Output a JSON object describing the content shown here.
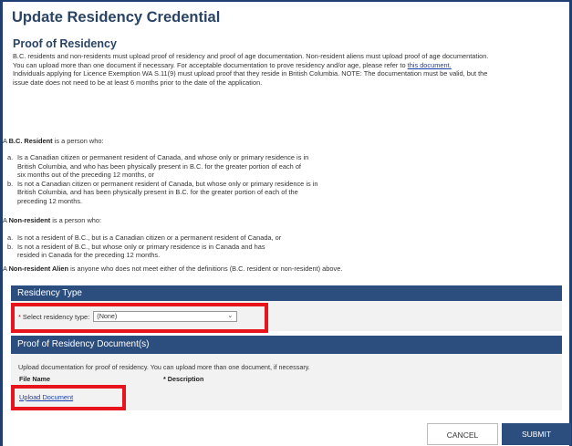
{
  "page": {
    "title": "Update Residency Credential"
  },
  "proof": {
    "heading": "Proof of Residency",
    "intro_line1": "B.C. residents and non-residents must upload proof of residency and proof of age documentation. Non-resident aliens must upload proof of age documentation.",
    "intro_line2": "You can upload more than one document if necessary. For acceptable documentation to prove residency and/or age, please refer to",
    "intro_link": "this document.",
    "intro_line3": "Individuals applying for Licence Exemption WA S.11(9) must upload proof that they reside in British Columbia. NOTE: The documentation must be valid, but the",
    "intro_line4": "issue date does not need to be at least 6 months prior to the date of the application."
  },
  "bc_resident": {
    "prefix": "A",
    "term": "B.C. Resident",
    "suffix": "is a person who:",
    "items": [
      {
        "mark": "a.",
        "lines": [
          "Is a Canadian citizen or permanent resident of Canada, and whose only or primary residence is in",
          "British Columbia, and who has been physically present in B.C. for the greater portion of each of",
          "six months out of the preceding 12 months, or"
        ]
      },
      {
        "mark": "b.",
        "lines": [
          "Is not a Canadian citizen or permanent resident of Canada, but whose only or primary residence is in",
          "British Columbia, and has been physically present in B.C. for the greater portion of each of the",
          "preceding 12 months."
        ]
      }
    ]
  },
  "non_resident": {
    "prefix": "A",
    "term": "Non-resident",
    "suffix": "is a person who:",
    "items": [
      {
        "mark": "a.",
        "lines": [
          "Is not a resident of B.C., but is a Canadian citizen or a permanent resident of Canada, or"
        ]
      },
      {
        "mark": "b.",
        "lines": [
          "Is not a resident of B.C., but whose only or primary residence is in Canada and has",
          "resided in Canada for the preceding 12 months."
        ]
      }
    ]
  },
  "alien": {
    "prefix": "A",
    "term": "Non-resident Alien",
    "suffix": "is anyone who does not meet either of the definitions (B.C. resident or non-resident) above."
  },
  "residency_type": {
    "band_label": "Residency Type",
    "required_mark": "*",
    "select_label": "Select residency type:",
    "selected_value": "(None)"
  },
  "documents": {
    "band_label": "Proof of Residency Document(s)",
    "note": "Upload documentation for proof of residency. You can upload more than one document, if necessary.",
    "col_file_name": "File Name",
    "col_description": "* Description",
    "upload_link": "Upload Document"
  },
  "actions": {
    "cancel": "CANCEL",
    "submit": "SUBMIT"
  },
  "colors": {
    "band": "#2c4e7f",
    "highlight": "#e8141b",
    "link": "#1a3fb0"
  }
}
